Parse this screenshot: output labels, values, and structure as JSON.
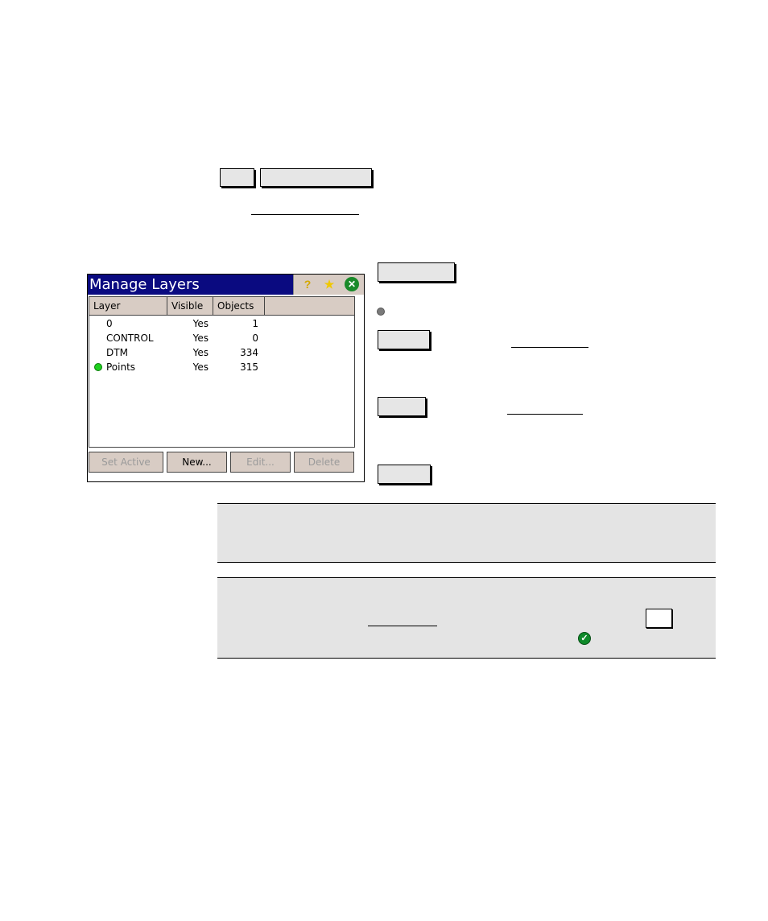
{
  "dialog": {
    "title": "Manage Layers",
    "titlebar_icons": [
      "help-icon",
      "favorites-star-icon",
      "close-icon"
    ],
    "columns": [
      "Layer",
      "Visible",
      "Objects"
    ],
    "rows": [
      {
        "layer": "0",
        "visible": "Yes",
        "objects": "1",
        "active": false
      },
      {
        "layer": "CONTROL",
        "visible": "Yes",
        "objects": "0",
        "active": false
      },
      {
        "layer": "DTM",
        "visible": "Yes",
        "objects": "334",
        "active": false
      },
      {
        "layer": "Points",
        "visible": "Yes",
        "objects": "315",
        "active": true
      }
    ],
    "buttons": [
      {
        "label": "Set Active",
        "enabled": false
      },
      {
        "label": "New...",
        "enabled": true
      },
      {
        "label": "Edit...",
        "enabled": false
      },
      {
        "label": "Delete",
        "enabled": false
      }
    ]
  },
  "colors": {
    "titlebar": "#0a0a80",
    "chrome": "#d8ccc4",
    "active_dot": "#1fd01f",
    "note_background": "#e4e4e4",
    "check": "#0f8a2a"
  }
}
